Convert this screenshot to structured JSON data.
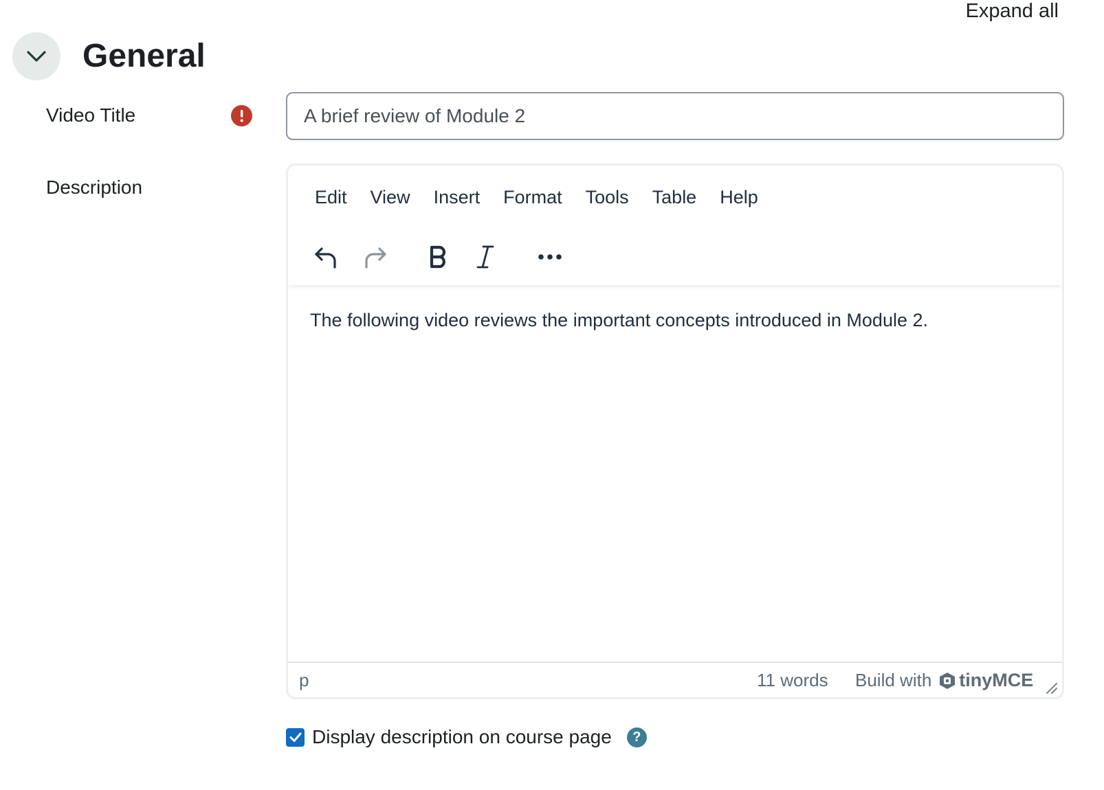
{
  "header": {
    "expand_all": "Expand all",
    "section_title": "General"
  },
  "form": {
    "video_title": {
      "label": "Video Title",
      "value": "A brief review of Module 2"
    },
    "description": {
      "label": "Description"
    }
  },
  "editor": {
    "menus": [
      "Edit",
      "View",
      "Insert",
      "Format",
      "Tools",
      "Table",
      "Help"
    ],
    "toolbar": [
      "undo-icon",
      "redo-icon",
      "bold-icon",
      "italic-icon",
      "more-icon"
    ],
    "content": "The following video reviews the important concepts introduced in Module 2.",
    "status": {
      "path": "p",
      "word_count": "11 words",
      "build_with": "Build with",
      "brand": "tinyMCE"
    }
  },
  "options": {
    "display_description_label": "Display description on course page",
    "display_description_checked": true
  },
  "colors": {
    "required": "#c0392b",
    "checkbox": "#0f6cbf",
    "help": "#3d7d95",
    "toggle_bg": "#e6ebe9"
  }
}
